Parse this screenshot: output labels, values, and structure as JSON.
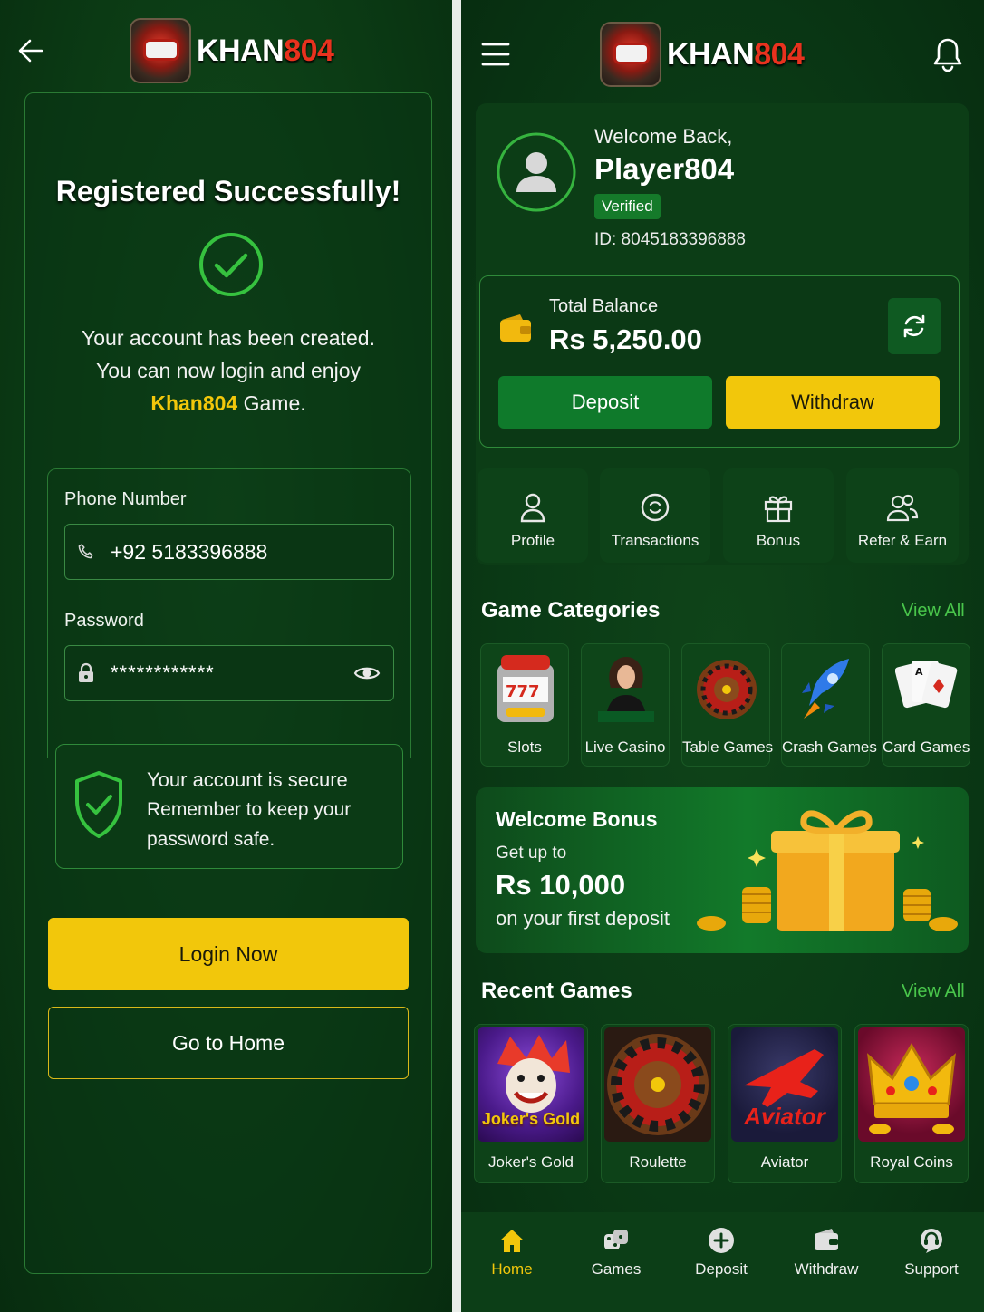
{
  "brand": {
    "name_part1": "KHAN",
    "name_part2": "804"
  },
  "register": {
    "title": "Registered Successfully!",
    "message_line1": "Your account has been created.",
    "message_line2": "You can now login and enjoy",
    "brand_highlight": "Khan804",
    "message_game": " Game.",
    "phone_label": "Phone Number",
    "phone_value": "+92 5183396888",
    "password_label": "Password",
    "password_value": "************",
    "secure_title": "Your account is secure",
    "secure_line1": "Remember to keep your",
    "secure_line2": "password safe.",
    "login_button": "Login Now",
    "home_button": "Go to Home"
  },
  "home": {
    "welcome": "Welcome Back,",
    "player": "Player804",
    "verified": "Verified",
    "player_id": "ID: 8045183396888",
    "balance_label": "Total Balance",
    "balance_value": "Rs 5,250.00",
    "deposit_button": "Deposit",
    "withdraw_button": "Withdraw",
    "quick": [
      {
        "label": "Profile",
        "icon": "user-icon"
      },
      {
        "label": "Transactions",
        "icon": "transactions-icon"
      },
      {
        "label": "Bonus",
        "icon": "gift-icon"
      },
      {
        "label": "Refer & Earn",
        "icon": "users-icon"
      }
    ],
    "categories_title": "Game Categories",
    "view_all": "View All",
    "categories": [
      {
        "label": "Slots"
      },
      {
        "label": "Live Casino"
      },
      {
        "label": "Table Games"
      },
      {
        "label": "Crash Games"
      },
      {
        "label": "Card Games"
      }
    ],
    "bonus": {
      "title": "Welcome Bonus",
      "subtitle": "Get up to",
      "amount": "Rs 10,000",
      "note": "on your first deposit"
    },
    "recent_title": "Recent Games",
    "recent": [
      {
        "label": "Joker's Gold",
        "art_text": "Joker's Gold"
      },
      {
        "label": "Roulette"
      },
      {
        "label": "Aviator",
        "art_text": "Aviator"
      },
      {
        "label": "Royal Coins"
      }
    ],
    "nav": [
      {
        "label": "Home",
        "active": true
      },
      {
        "label": "Games"
      },
      {
        "label": "Deposit"
      },
      {
        "label": "Withdraw"
      },
      {
        "label": "Support"
      }
    ]
  },
  "colors": {
    "accent_yellow": "#f2c70b",
    "accent_green": "#49c64b",
    "bg_green": "#0a3915"
  }
}
